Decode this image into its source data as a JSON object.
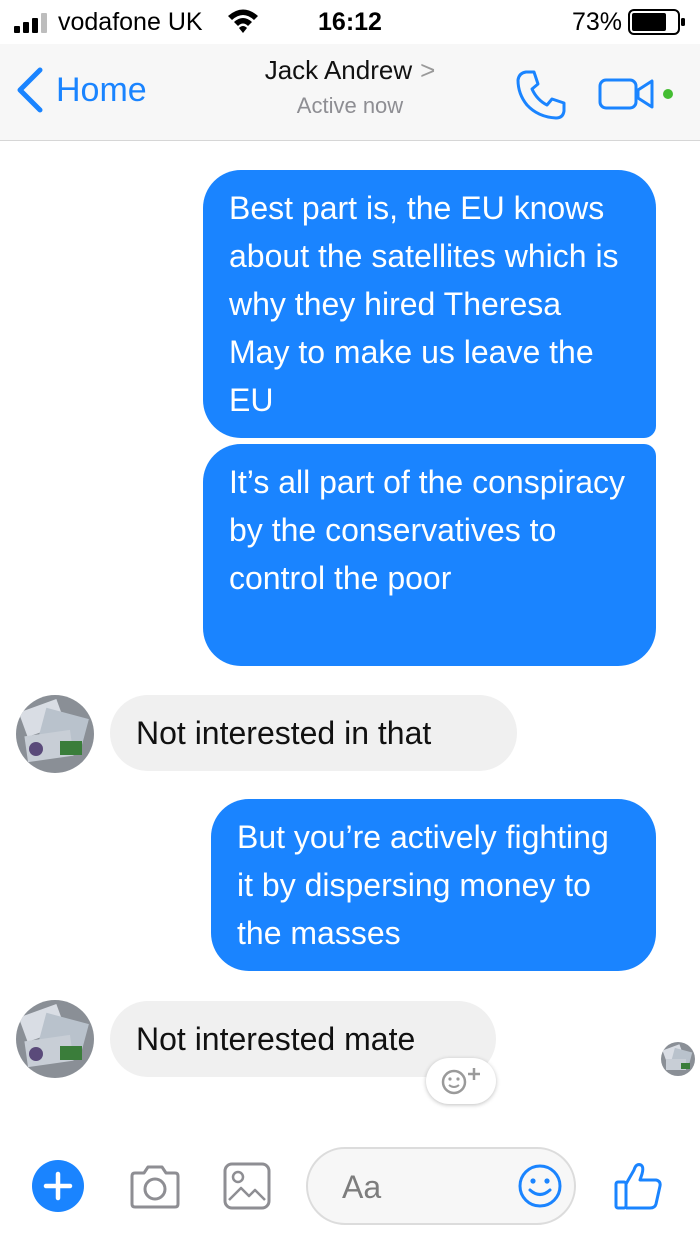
{
  "status_bar": {
    "carrier": "vodafone UK",
    "time": "16:12",
    "battery": "73%"
  },
  "nav": {
    "back_label": "Home",
    "contact_name": "Jack Andrew",
    "contact_chevron": ">",
    "contact_status": "Active now"
  },
  "messages": [
    {
      "from": "me",
      "text": "Best part is, the EU knows about the satellites which is why they hired Theresa May to make us leave the EU"
    },
    {
      "from": "me",
      "text": "It’s all part of the conspiracy by the conservatives to control the poor"
    },
    {
      "from": "them",
      "text": "Not interested in that"
    },
    {
      "from": "me",
      "text": "But you’re actively fighting it by dispersing money to the masses"
    },
    {
      "from": "them",
      "text": "Not interested mate"
    }
  ],
  "composer": {
    "placeholder": "Aa"
  },
  "colors": {
    "accent": "#1a84ff",
    "incoming_bubble": "#f0f0f0",
    "active_dot": "#44bd32"
  },
  "icons": [
    "signal-icon",
    "wifi-icon",
    "battery-icon",
    "back-chevron-icon",
    "phone-icon",
    "video-camera-icon",
    "reaction-add-icon",
    "plus-icon",
    "camera-icon",
    "image-icon",
    "emoji-icon",
    "thumbs-up-icon"
  ]
}
